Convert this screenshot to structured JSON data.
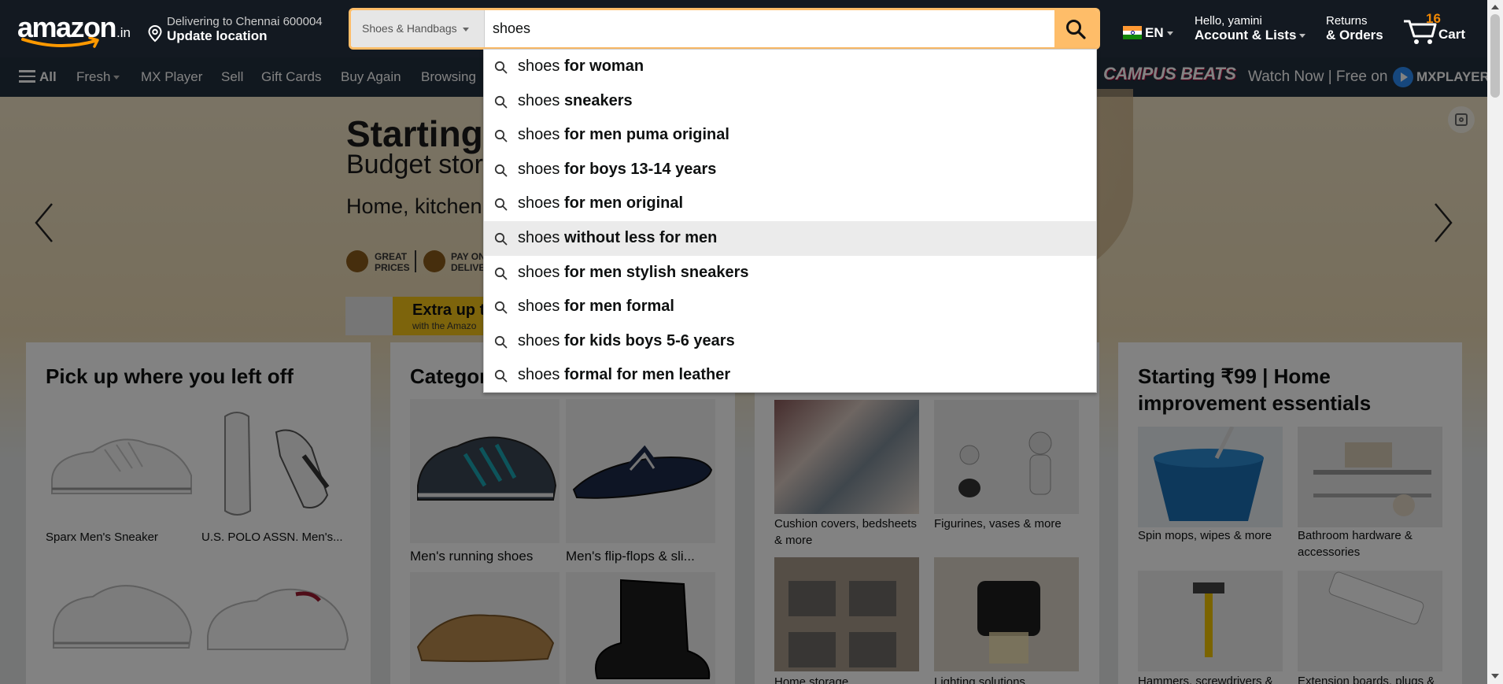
{
  "header": {
    "logo_text": "amazon",
    "logo_tld": ".in",
    "delivery_line1": "Delivering to Chennai 600004",
    "delivery_line2": "Update location",
    "search_category": "Shoes & Handbags",
    "search_value": "shoes",
    "language": "EN",
    "account_line1": "Hello, yamini",
    "account_line2": "Account & Lists",
    "returns_line1": "Returns",
    "returns_line2": "& Orders",
    "cart_count": "16",
    "cart_label": "Cart"
  },
  "subnav": {
    "all": "All",
    "fresh": "Fresh",
    "mx_player": "MX Player",
    "sell": "Sell",
    "gift_cards": "Gift Cards",
    "buy_again": "Buy Again",
    "browsing": "Browsing"
  },
  "promo": {
    "brand": "CAMPUS BEATS",
    "watch": "Watch Now | Free on",
    "mx": "MXPLAYER"
  },
  "hero": {
    "title": "Starting ",
    "subtitle": "Budget store",
    "line3": "Home, kitchen",
    "badge1": "GREAT PRICES",
    "badge1_a": "GREAT",
    "badge1_b": "PRICES",
    "badge2_a": "PAY ON",
    "badge2_b": "DELIVE",
    "offer_title": "Extra up to",
    "offer_sub": "with the Amazo"
  },
  "suggestions": [
    {
      "q": "shoes",
      "rest": "for woman"
    },
    {
      "q": "shoes",
      "rest": "sneakers"
    },
    {
      "q": "shoes",
      "rest": "for men puma original"
    },
    {
      "q": "shoes",
      "rest": "for boys 13-14 years"
    },
    {
      "q": "shoes",
      "rest": "for men original"
    },
    {
      "q": "shoes",
      "rest": "without less for men"
    },
    {
      "q": "shoes",
      "rest": "for men stylish sneakers"
    },
    {
      "q": "shoes",
      "rest": "for men formal"
    },
    {
      "q": "shoes",
      "rest": "for kids boys 5-6 years"
    },
    {
      "q": "shoes",
      "rest": "formal for men leather"
    }
  ],
  "cards": {
    "left_title": "Pick up where you left off",
    "left_items": [
      "Sparx Men's Sneaker",
      "U.S. POLO ASSN. Men's..."
    ],
    "mid_title": "Categor",
    "mid_items": [
      "Men's running shoes",
      "Men's flip-flops & sli..."
    ],
    "decor_items": [
      "Cushion covers, bedsheets & more",
      "Figurines, vases & more",
      "Home storage",
      "Lighting solutions"
    ],
    "right_title": "Starting ₹99 | Home improvement essentials",
    "right_items": [
      "Spin mops, wipes & more",
      "Bathroom hardware & accessories",
      "Hammers, screwdrivers &",
      "Extension boards, plugs &"
    ]
  },
  "colors": {
    "nav_dark": "#131921",
    "nav_sub": "#232f3e",
    "search_accent": "#febd69",
    "cart_count": "#f08804"
  }
}
